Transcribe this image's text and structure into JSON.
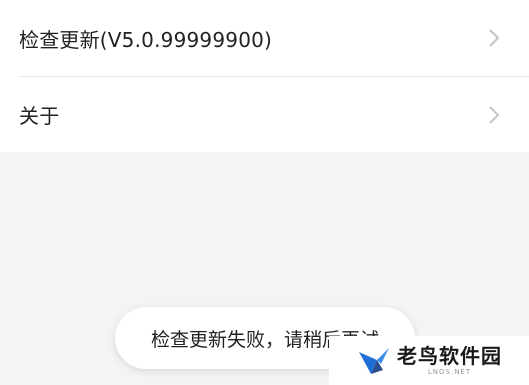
{
  "settings": {
    "items": [
      {
        "label": "检查更新(V5.0.99999900)"
      },
      {
        "label": "关于"
      }
    ]
  },
  "toast": {
    "message": "检查更新失败，请稍后再试"
  },
  "watermark": {
    "title": "老鸟软件园",
    "subtitle": "LNOS.NET"
  },
  "colors": {
    "page_bg": "#f4f4f4",
    "list_bg": "#ffffff",
    "text": "#222222",
    "chevron": "#c4c4c4",
    "logo_blue": "#1f6fd6"
  },
  "icons": [
    "chevron-right-icon",
    "bird-logo-icon"
  ]
}
